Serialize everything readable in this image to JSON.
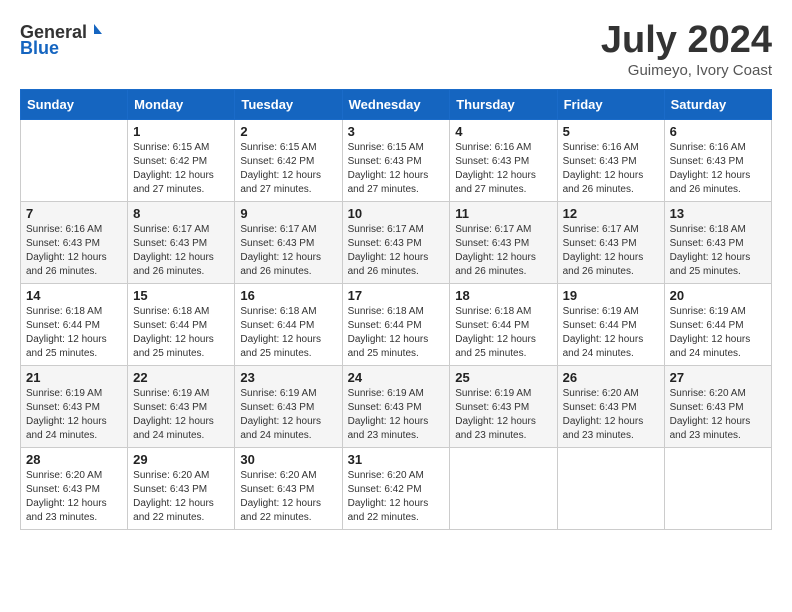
{
  "header": {
    "logo_general": "General",
    "logo_blue": "Blue",
    "title": "July 2024",
    "subtitle": "Guimeyo, Ivory Coast"
  },
  "weekdays": [
    "Sunday",
    "Monday",
    "Tuesday",
    "Wednesday",
    "Thursday",
    "Friday",
    "Saturday"
  ],
  "weeks": [
    [
      {
        "day": "",
        "sunrise": "",
        "sunset": "",
        "daylight": ""
      },
      {
        "day": "1",
        "sunrise": "Sunrise: 6:15 AM",
        "sunset": "Sunset: 6:42 PM",
        "daylight": "Daylight: 12 hours and 27 minutes."
      },
      {
        "day": "2",
        "sunrise": "Sunrise: 6:15 AM",
        "sunset": "Sunset: 6:42 PM",
        "daylight": "Daylight: 12 hours and 27 minutes."
      },
      {
        "day": "3",
        "sunrise": "Sunrise: 6:15 AM",
        "sunset": "Sunset: 6:43 PM",
        "daylight": "Daylight: 12 hours and 27 minutes."
      },
      {
        "day": "4",
        "sunrise": "Sunrise: 6:16 AM",
        "sunset": "Sunset: 6:43 PM",
        "daylight": "Daylight: 12 hours and 27 minutes."
      },
      {
        "day": "5",
        "sunrise": "Sunrise: 6:16 AM",
        "sunset": "Sunset: 6:43 PM",
        "daylight": "Daylight: 12 hours and 26 minutes."
      },
      {
        "day": "6",
        "sunrise": "Sunrise: 6:16 AM",
        "sunset": "Sunset: 6:43 PM",
        "daylight": "Daylight: 12 hours and 26 minutes."
      }
    ],
    [
      {
        "day": "7",
        "sunrise": "Sunrise: 6:16 AM",
        "sunset": "Sunset: 6:43 PM",
        "daylight": "Daylight: 12 hours and 26 minutes."
      },
      {
        "day": "8",
        "sunrise": "Sunrise: 6:17 AM",
        "sunset": "Sunset: 6:43 PM",
        "daylight": "Daylight: 12 hours and 26 minutes."
      },
      {
        "day": "9",
        "sunrise": "Sunrise: 6:17 AM",
        "sunset": "Sunset: 6:43 PM",
        "daylight": "Daylight: 12 hours and 26 minutes."
      },
      {
        "day": "10",
        "sunrise": "Sunrise: 6:17 AM",
        "sunset": "Sunset: 6:43 PM",
        "daylight": "Daylight: 12 hours and 26 minutes."
      },
      {
        "day": "11",
        "sunrise": "Sunrise: 6:17 AM",
        "sunset": "Sunset: 6:43 PM",
        "daylight": "Daylight: 12 hours and 26 minutes."
      },
      {
        "day": "12",
        "sunrise": "Sunrise: 6:17 AM",
        "sunset": "Sunset: 6:43 PM",
        "daylight": "Daylight: 12 hours and 26 minutes."
      },
      {
        "day": "13",
        "sunrise": "Sunrise: 6:18 AM",
        "sunset": "Sunset: 6:43 PM",
        "daylight": "Daylight: 12 hours and 25 minutes."
      }
    ],
    [
      {
        "day": "14",
        "sunrise": "Sunrise: 6:18 AM",
        "sunset": "Sunset: 6:44 PM",
        "daylight": "Daylight: 12 hours and 25 minutes."
      },
      {
        "day": "15",
        "sunrise": "Sunrise: 6:18 AM",
        "sunset": "Sunset: 6:44 PM",
        "daylight": "Daylight: 12 hours and 25 minutes."
      },
      {
        "day": "16",
        "sunrise": "Sunrise: 6:18 AM",
        "sunset": "Sunset: 6:44 PM",
        "daylight": "Daylight: 12 hours and 25 minutes."
      },
      {
        "day": "17",
        "sunrise": "Sunrise: 6:18 AM",
        "sunset": "Sunset: 6:44 PM",
        "daylight": "Daylight: 12 hours and 25 minutes."
      },
      {
        "day": "18",
        "sunrise": "Sunrise: 6:18 AM",
        "sunset": "Sunset: 6:44 PM",
        "daylight": "Daylight: 12 hours and 25 minutes."
      },
      {
        "day": "19",
        "sunrise": "Sunrise: 6:19 AM",
        "sunset": "Sunset: 6:44 PM",
        "daylight": "Daylight: 12 hours and 24 minutes."
      },
      {
        "day": "20",
        "sunrise": "Sunrise: 6:19 AM",
        "sunset": "Sunset: 6:44 PM",
        "daylight": "Daylight: 12 hours and 24 minutes."
      }
    ],
    [
      {
        "day": "21",
        "sunrise": "Sunrise: 6:19 AM",
        "sunset": "Sunset: 6:43 PM",
        "daylight": "Daylight: 12 hours and 24 minutes."
      },
      {
        "day": "22",
        "sunrise": "Sunrise: 6:19 AM",
        "sunset": "Sunset: 6:43 PM",
        "daylight": "Daylight: 12 hours and 24 minutes."
      },
      {
        "day": "23",
        "sunrise": "Sunrise: 6:19 AM",
        "sunset": "Sunset: 6:43 PM",
        "daylight": "Daylight: 12 hours and 24 minutes."
      },
      {
        "day": "24",
        "sunrise": "Sunrise: 6:19 AM",
        "sunset": "Sunset: 6:43 PM",
        "daylight": "Daylight: 12 hours and 23 minutes."
      },
      {
        "day": "25",
        "sunrise": "Sunrise: 6:19 AM",
        "sunset": "Sunset: 6:43 PM",
        "daylight": "Daylight: 12 hours and 23 minutes."
      },
      {
        "day": "26",
        "sunrise": "Sunrise: 6:20 AM",
        "sunset": "Sunset: 6:43 PM",
        "daylight": "Daylight: 12 hours and 23 minutes."
      },
      {
        "day": "27",
        "sunrise": "Sunrise: 6:20 AM",
        "sunset": "Sunset: 6:43 PM",
        "daylight": "Daylight: 12 hours and 23 minutes."
      }
    ],
    [
      {
        "day": "28",
        "sunrise": "Sunrise: 6:20 AM",
        "sunset": "Sunset: 6:43 PM",
        "daylight": "Daylight: 12 hours and 23 minutes."
      },
      {
        "day": "29",
        "sunrise": "Sunrise: 6:20 AM",
        "sunset": "Sunset: 6:43 PM",
        "daylight": "Daylight: 12 hours and 22 minutes."
      },
      {
        "day": "30",
        "sunrise": "Sunrise: 6:20 AM",
        "sunset": "Sunset: 6:43 PM",
        "daylight": "Daylight: 12 hours and 22 minutes."
      },
      {
        "day": "31",
        "sunrise": "Sunrise: 6:20 AM",
        "sunset": "Sunset: 6:42 PM",
        "daylight": "Daylight: 12 hours and 22 minutes."
      },
      {
        "day": "",
        "sunrise": "",
        "sunset": "",
        "daylight": ""
      },
      {
        "day": "",
        "sunrise": "",
        "sunset": "",
        "daylight": ""
      },
      {
        "day": "",
        "sunrise": "",
        "sunset": "",
        "daylight": ""
      }
    ]
  ]
}
